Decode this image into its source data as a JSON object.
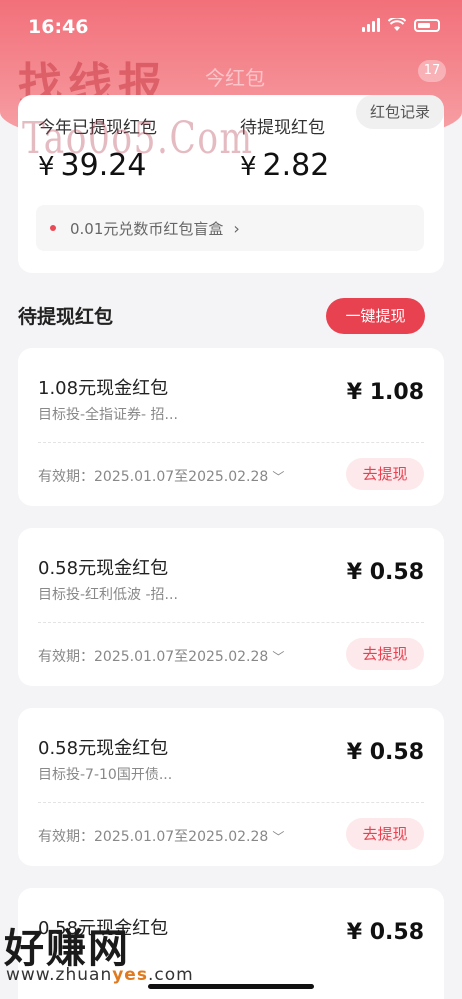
{
  "status_bar": {
    "time": "16:46"
  },
  "watermarks": {
    "top": "找线报",
    "ghost": "今红包",
    "tao": "Tao0o5.Com",
    "bottom": "好赚网",
    "url_prefix": "www.zhuan",
    "url_highlight": "yes",
    "url_suffix": ".com"
  },
  "header": {
    "badge": "17",
    "record_label": "红包记录"
  },
  "summary": {
    "withdrawn_label": "今年已提现红包",
    "withdrawn_currency": "¥",
    "withdrawn_value": "39.24",
    "pending_label": "待提现红包",
    "pending_currency": "¥",
    "pending_value": "2.82",
    "promo_text": "0.01元兑数币红包盲盒",
    "promo_chevron": "›"
  },
  "pending_section": {
    "title": "待提现红包",
    "onekey_label": "一键提现"
  },
  "envelopes": [
    {
      "title": "1.08元现金红包",
      "subtitle": "目标投-全指证券- 招...",
      "amount": "¥ 1.08",
      "validity": "有效期：2025.01.07至2025.02.28",
      "action": "去提现"
    },
    {
      "title": "0.58元现金红包",
      "subtitle": "目标投-红利低波 -招...",
      "amount": "¥ 0.58",
      "validity": "有效期：2025.01.07至2025.02.28",
      "action": "去提现"
    },
    {
      "title": "0.58元现金红包",
      "subtitle": "目标投-7-10国开债...",
      "amount": "¥ 0.58",
      "validity": "有效期：2025.01.07至2025.02.28",
      "action": "去提现"
    },
    {
      "title": "0.58元现金红包",
      "subtitle": "",
      "amount": "¥ 0.58",
      "validity": "",
      "action": ""
    }
  ],
  "colors": {
    "accent": "#e8414f",
    "hero": "#f2707a",
    "background": "#f4f4f6"
  }
}
